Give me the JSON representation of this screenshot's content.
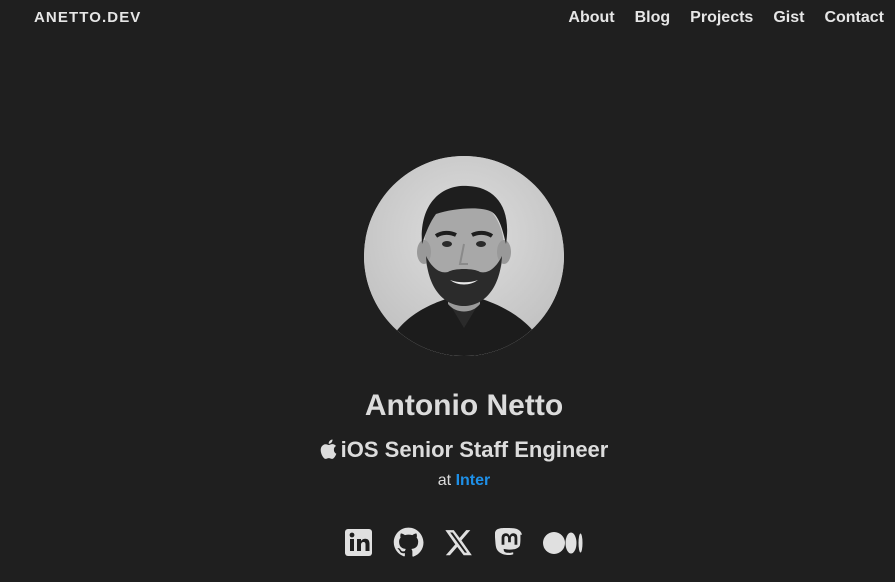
{
  "header": {
    "logo": "ANETTO.DEV",
    "nav": [
      "About",
      "Blog",
      "Projects",
      "Gist",
      "Contact"
    ]
  },
  "profile": {
    "name": "Antonio Netto",
    "role": "iOS Senior Staff Engineer",
    "at_prefix": "at",
    "company": "Inter"
  },
  "socials": [
    "linkedin-icon",
    "github-icon",
    "x-icon",
    "mastodon-icon",
    "medium-icon"
  ],
  "colors": {
    "background": "#1f1f1f",
    "text": "#dcdcdc",
    "link": "#1e90e8"
  }
}
